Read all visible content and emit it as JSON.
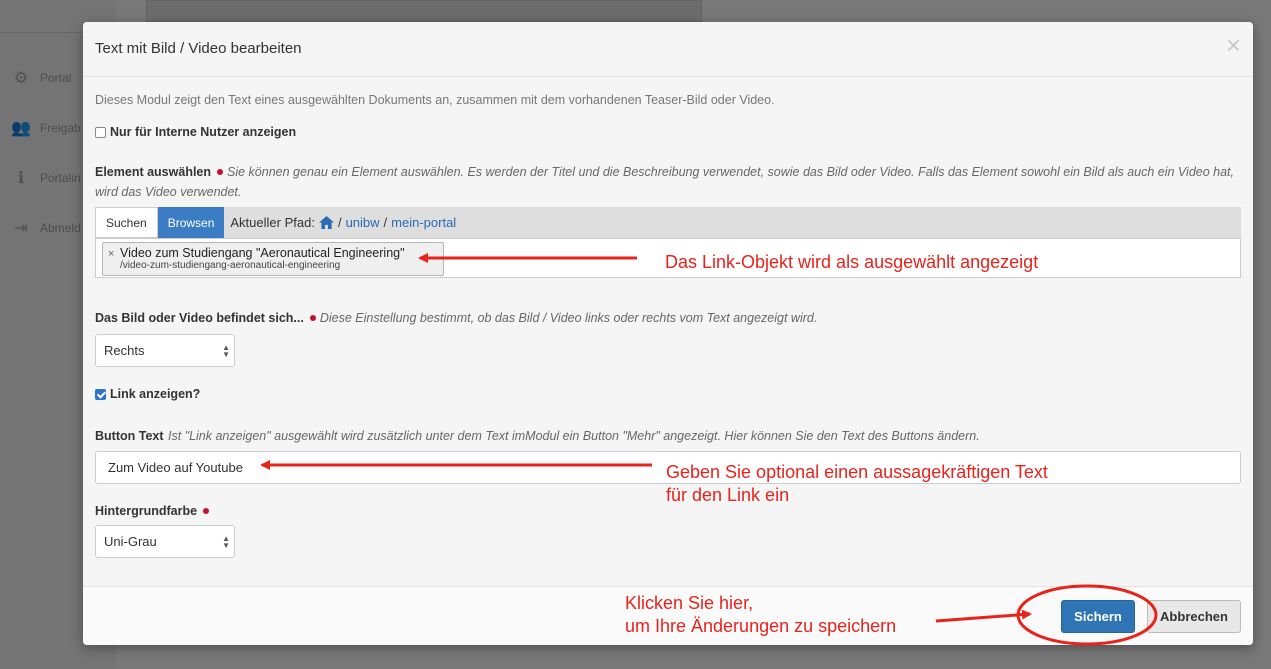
{
  "background": {
    "sidebar": [
      {
        "icon": "gear-group-icon",
        "label": "Portal"
      },
      {
        "icon": "users-icon",
        "label": "Freigab"
      },
      {
        "icon": "info-icon",
        "label": "Portalin"
      },
      {
        "icon": "logout-icon",
        "label": "Abmeld"
      }
    ]
  },
  "modal": {
    "title": "Text mit Bild / Video bearbeiten",
    "close_label": "×",
    "intro": "Dieses Modul zeigt den Text eines ausgewählten Dokuments an, zusammen mit dem vorhandenen Teaser-Bild oder Video.",
    "internal_only": {
      "label": "Nur für Interne Nutzer anzeigen",
      "checked": false
    },
    "element": {
      "label": "Element auswählen",
      "hint": "Sie können genau ein Element auswählen. Es werden der Titel und die Beschreibung verwendet, sowie das Bild oder Video. Falls das Element sowohl ein Bild als auch ein Video hat, wird das Video verwendet.",
      "tab_search": "Suchen",
      "tab_browse": "Browsen",
      "path_label": "Aktueller Pfad:",
      "path": [
        "unibw",
        "mein-portal"
      ],
      "path_sep": "/",
      "selected_remove": "×",
      "selected_title": "Video zum Studiengang \"Aeronautical Engineering\"",
      "selected_path": "/video-zum-studiengang-aeronautical-engineering"
    },
    "position": {
      "label": "Das Bild oder Video befindet sich...",
      "hint": "Diese Einstellung bestimmt, ob das Bild / Video links oder rechts vom Text angezeigt wird.",
      "value": "Rechts"
    },
    "show_link": {
      "label": "Link anzeigen?",
      "checked": true
    },
    "button_text": {
      "label": "Button Text",
      "hint": "Ist \"Link anzeigen\" ausgewählt wird zusätzlich unter dem Text imModul ein Button \"Mehr\" angezeigt. Hier können Sie den Text des Buttons ändern.",
      "value": "Zum Video auf Youtube"
    },
    "background_color": {
      "label": "Hintergrundfarbe",
      "value": "Uni-Grau"
    },
    "save_label": "Sichern",
    "cancel_label": "Abbrechen"
  },
  "annotations": {
    "link_object": "Das Link-Objekt wird als ausgewählt angezeigt",
    "link_text_line1": "Geben Sie optional einen aussagekräftigen Text",
    "link_text_line2": "für den Link ein",
    "save_line1": "Klicken Sie hier,",
    "save_line2": "um Ihre Änderungen zu speichern",
    "color": "#e8231c"
  }
}
